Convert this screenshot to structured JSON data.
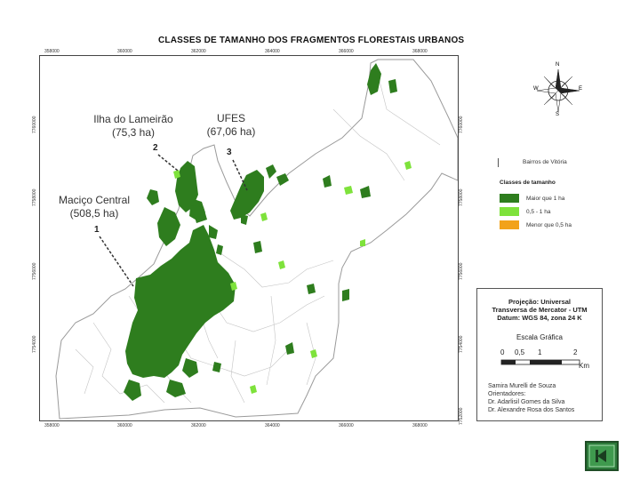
{
  "map": {
    "title": "CLASSES DE TAMANHO DOS FRAGMENTOS FLORESTAIS URBANOS",
    "top_coords": [
      "358000",
      "360000",
      "362000",
      "364000",
      "366000",
      "368000"
    ],
    "bottom_coords": [
      "358000",
      "360000",
      "362000",
      "364000",
      "366000",
      "368000"
    ],
    "left_coords": [
      "7760000",
      "7758000",
      "7756000",
      "7754000"
    ],
    "right_coords": [
      "7760000",
      "7758000",
      "7756000",
      "7754000",
      "7752000"
    ]
  },
  "annotations": [
    {
      "name": "Ilha do Lameirão",
      "area": "(75,3 ha)",
      "number": "2"
    },
    {
      "name": "UFES",
      "area": "(67,06 ha)",
      "number": "3"
    },
    {
      "name": "Maciço Central",
      "area": "(508,5 ha)",
      "number": "1"
    }
  ],
  "compass": {
    "n": "N",
    "s": "S",
    "e": "E",
    "w": "W"
  },
  "legend": {
    "boundary_label": "Bairros de Vitória",
    "title": "Classes de tamanho",
    "items": [
      {
        "label": "Maior que 1 ha",
        "color": "#2e7d1e"
      },
      {
        "label": "0,5 - 1 ha",
        "color": "#7ee23b"
      },
      {
        "label": "Menor que 0,5 ha",
        "color": "#f2a21b"
      }
    ]
  },
  "info": {
    "projection_line1": "Projeção: Universal",
    "projection_line2": "Transversa de Mercator - UTM",
    "projection_line3": "Datum: WGS 84, zona 24 K",
    "scale_title": "Escala Gráfica",
    "scale_ticks": [
      "0",
      "0,5",
      "1",
      "2"
    ],
    "scale_unit": "Km",
    "credits": [
      "Samira Murelli de Souza",
      "Orientadores:",
      "Dr. Adarlisil Gomes da Silva",
      "Dr. Alexandre Rosa dos Santos"
    ]
  },
  "colors": {
    "large": "#2e7d1e",
    "medium": "#7ee23b",
    "boundary": "#b8b8b8"
  },
  "nav": {
    "next_icon": "next-slide-icon"
  }
}
